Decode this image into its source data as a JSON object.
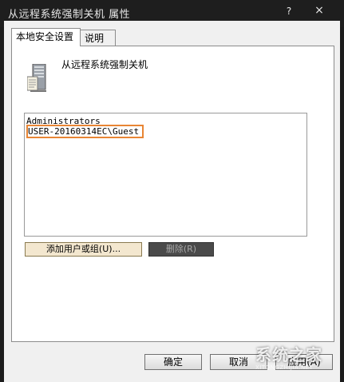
{
  "window": {
    "title": "从远程系统强制关机 属性",
    "help_glyph": "?",
    "close_glyph": "×"
  },
  "tabs": [
    {
      "label": "本地安全设置",
      "active": true
    },
    {
      "label": "说明",
      "active": false
    }
  ],
  "policy": {
    "icon": "server-policy-icon",
    "title": "从远程系统强制关机"
  },
  "principals": [
    {
      "name": "Administrators",
      "selected": false
    },
    {
      "name": "USER-20160314EC\\Guest",
      "selected": true
    }
  ],
  "actions": {
    "add_label": "添加用户或组(U)...",
    "remove_label": "删除(R)"
  },
  "footer": {
    "ok_label": "确定",
    "cancel_label": "取消",
    "apply_label": "应用(A)"
  },
  "watermark": {
    "text": "系统之家",
    "url": "XITONGZHIJIA.NET"
  },
  "colors": {
    "highlight": "#e88534",
    "titlebar": "#1e1e1e"
  }
}
